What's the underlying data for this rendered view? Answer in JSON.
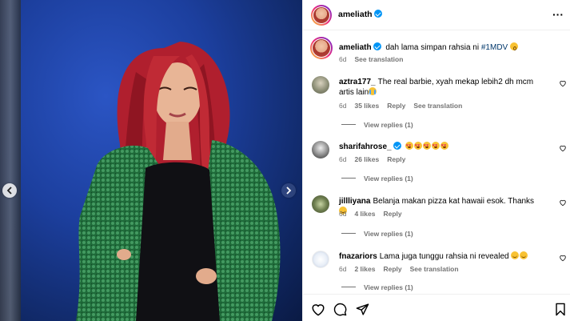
{
  "post": {
    "username": "ameliath",
    "caption_text": "dah lama simpan rahsia ni ",
    "caption_tag": "#1MDV",
    "caption_time": "6d",
    "caption_translate": "See translation"
  },
  "comments": [
    {
      "username": "aztra177_",
      "text": "The real barbie, xyah mekap lebih2 dh mcm artis lain",
      "emoji": [
        "cry"
      ],
      "time": "6d",
      "likes": "35 likes",
      "reply": "Reply",
      "translate": "See translation",
      "view_replies": "View replies (1)"
    },
    {
      "username": "sharifahrose_",
      "text": "",
      "emoji": [
        "hearteyes",
        "hearteyes",
        "hearteyes",
        "hearteyes",
        "hearteyes"
      ],
      "time": "6d",
      "likes": "26 likes",
      "reply": "Reply",
      "translate": "",
      "view_replies": "View replies (1)"
    },
    {
      "username": "jillliyana",
      "text": "Belanja makan pizza kat hawaii esok. Thanks ",
      "emoji": [
        "smile"
      ],
      "time": "6d",
      "likes": "4 likes",
      "reply": "Reply",
      "translate": "",
      "view_replies": "View replies (1)"
    },
    {
      "username": "fnazariors",
      "text": "Lama juga tunggu rahsia ni revealed ",
      "emoji": [
        "smile",
        "smile"
      ],
      "time": "6d",
      "likes": "2 likes",
      "reply": "Reply",
      "translate": "See translation",
      "view_replies": "View replies (1)"
    }
  ],
  "icons": {
    "header_more": "more-options-icon",
    "actions": [
      "heart-icon",
      "comment-icon",
      "share-icon",
      "bookmark-icon"
    ],
    "carousel": [
      "chevron-left-icon",
      "chevron-right-icon"
    ]
  },
  "colors": {
    "link": "#00376b",
    "verified": "#0095f6",
    "muted": "#737373",
    "backdrop": "#1c3f9e"
  }
}
